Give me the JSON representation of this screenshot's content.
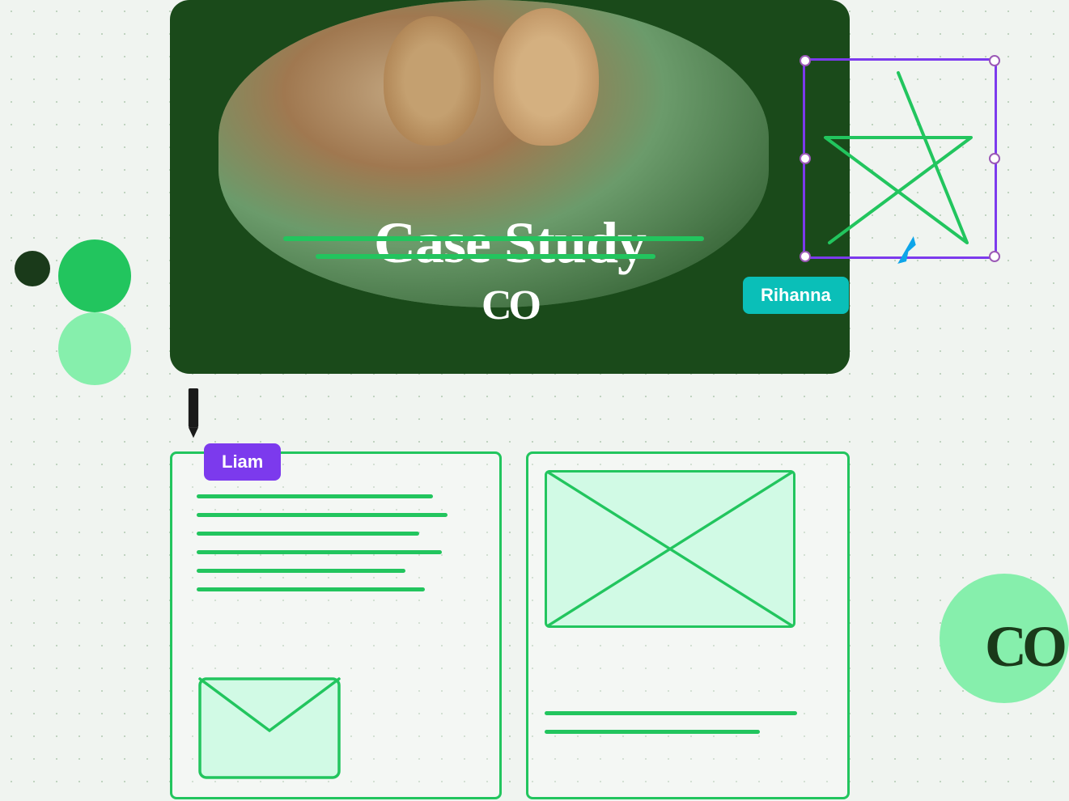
{
  "slide": {
    "title": "Case Study",
    "co_logo": "CO",
    "background_color": "#1a4a1a"
  },
  "rihanna_label": {
    "text": "Rihanna",
    "color": "#0abfb8"
  },
  "liam_label": {
    "text": "Liam",
    "color": "#7c3aed"
  },
  "co_logo_bottom": {
    "text": "CO"
  },
  "decorative": {
    "circle_dark": "#1a3a1a",
    "circle_green": "#22c55e",
    "circle_light": "#86efac",
    "selection_border": "#7c3aed",
    "cursor_color": "#0ea5e9"
  }
}
